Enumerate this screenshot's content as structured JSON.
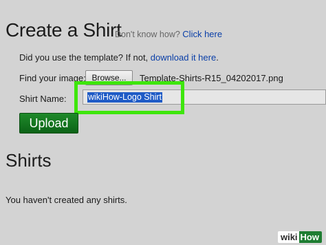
{
  "header": {
    "title": "Create a Shirt",
    "help_prefix": "Don't know how?",
    "help_link": "Click here"
  },
  "template": {
    "prompt": "Did you use the template? If not,",
    "link": "download it here",
    "suffix": "."
  },
  "image_picker": {
    "label": "Find your image:",
    "button_label": "Browse...",
    "file_name": "Template-Shirts-R15_04202017.png"
  },
  "shirt_name": {
    "label": "Shirt Name:",
    "value": "wikiHow-Logo Shirt"
  },
  "upload": {
    "button_label": "Upload"
  },
  "shirts_section": {
    "title": "Shirts",
    "empty_message": "You haven't created any shirts."
  },
  "watermark": {
    "part1": "wiki",
    "part2": "How"
  },
  "colors": {
    "background": "#d3d3d3",
    "link": "#0a3fa8",
    "upload_button": "#1a7a24",
    "highlight": "#3ee60c",
    "selection": "#1f5bc6"
  }
}
